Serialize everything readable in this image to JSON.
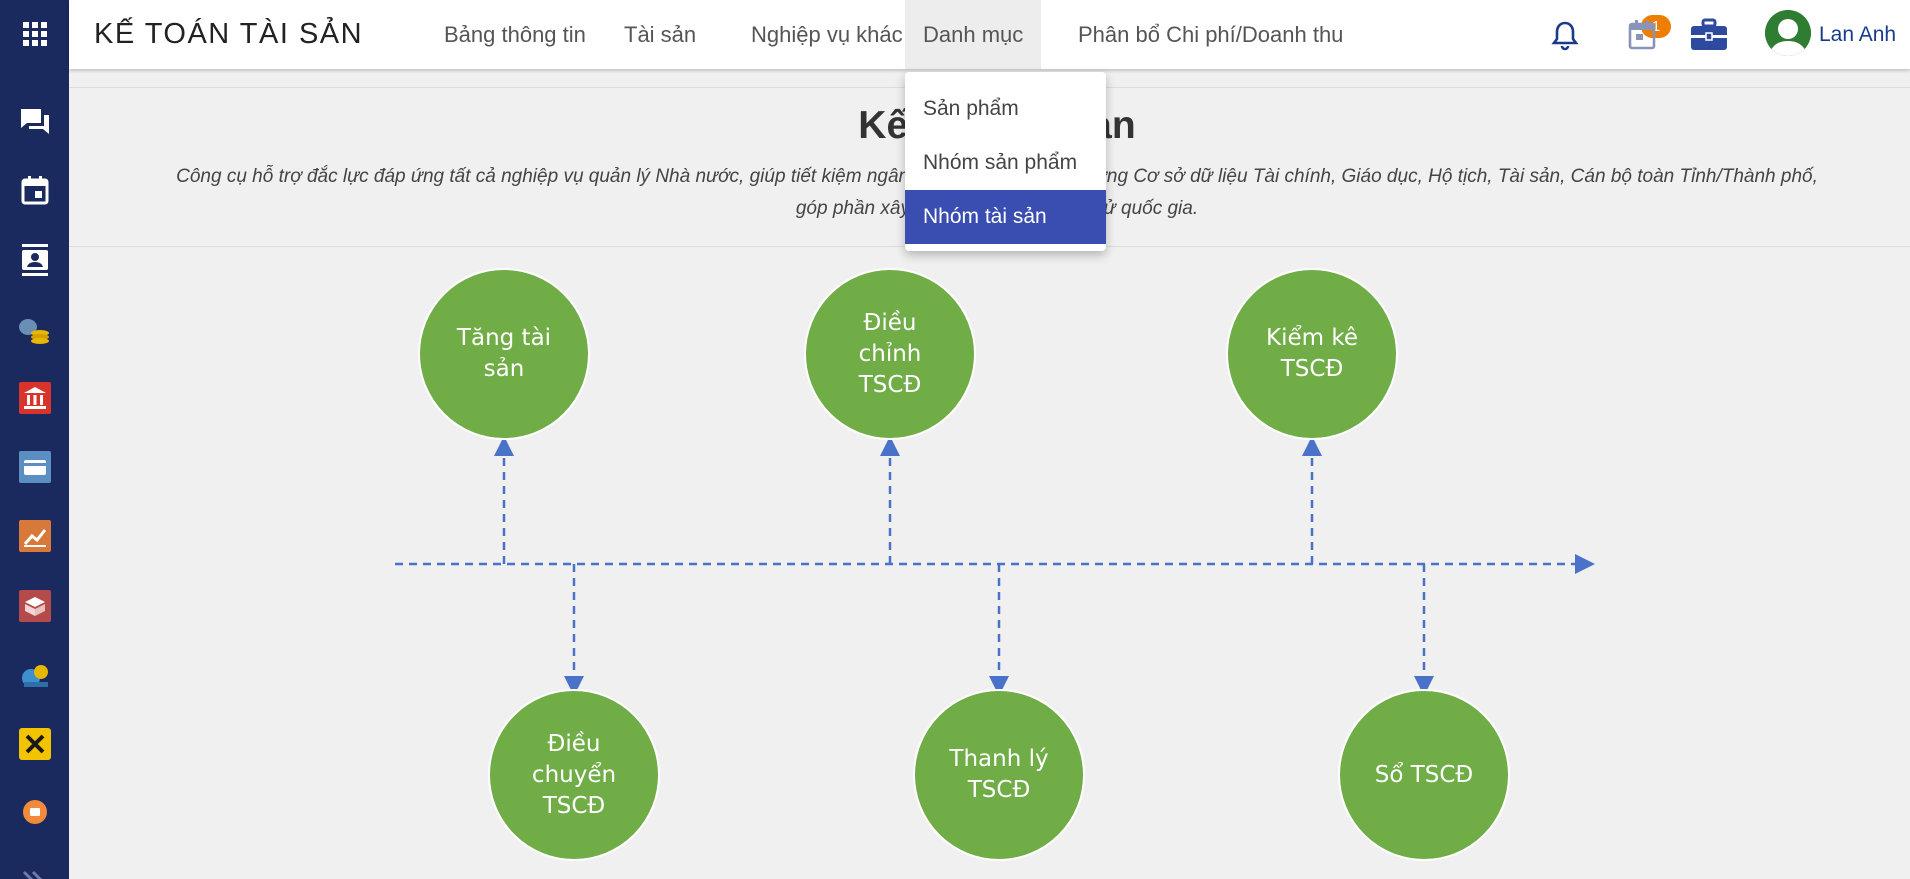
{
  "app": {
    "title": "KẾ TOÁN TÀI SẢN"
  },
  "nav": {
    "items": [
      {
        "label": "Bảng thông tin",
        "active": false
      },
      {
        "label": "Tài sản",
        "active": false
      },
      {
        "label": "Nghiệp vụ khác",
        "active": false
      },
      {
        "label": "Danh mục",
        "active": true
      },
      {
        "label": "Phân bổ Chi phí/Doanh thu",
        "active": false
      }
    ]
  },
  "dropdown": {
    "items": [
      {
        "label": "Sản phẩm",
        "selected": false
      },
      {
        "label": "Nhóm sản phẩm",
        "selected": false
      },
      {
        "label": "Nhóm tài sản",
        "selected": true
      }
    ]
  },
  "header_right": {
    "notification_count": "1",
    "user_name": "Lan Anh"
  },
  "content": {
    "heading": "Kế toán tài sản",
    "description_line1": "Công cụ hỗ trợ đắc lực đáp ứng tất cả nghiệp vụ quản lý Nhà nước, giúp tiết kiệm ngân sách, đồng thời xây dựng Cơ sở dữ liệu Tài chính, Giáo dục, Hộ tịch, Tài sản, Cán bộ toàn Tỉnh/Thành phố,",
    "description_line2": "góp phần xây dựng Chính phủ điện tử quốc gia."
  },
  "diagram": {
    "top_nodes": [
      "Tăng tài\nsản",
      "Điều\nchỉnh\nTSCĐ",
      "Kiểm kê\nTSCĐ"
    ],
    "bottom_nodes": [
      "Điều\nchuyển\nTSCĐ",
      "Thanh lý\nTSCĐ",
      "Sổ TSCĐ"
    ]
  },
  "rail_icons": [
    "apps-icon",
    "chat-icon",
    "calendar-icon",
    "contacts-icon",
    "coins-icon",
    "bank-icon",
    "card-icon",
    "chart-icon",
    "box-icon",
    "money-bag-icon",
    "tools-icon",
    "orange-circle-icon",
    "expand-icon"
  ],
  "colors": {
    "rail": "#1a2a5e",
    "accent": "#3a4db0",
    "node": "#70ad47",
    "connector": "#4a72c8",
    "badge": "#ef7d00"
  }
}
